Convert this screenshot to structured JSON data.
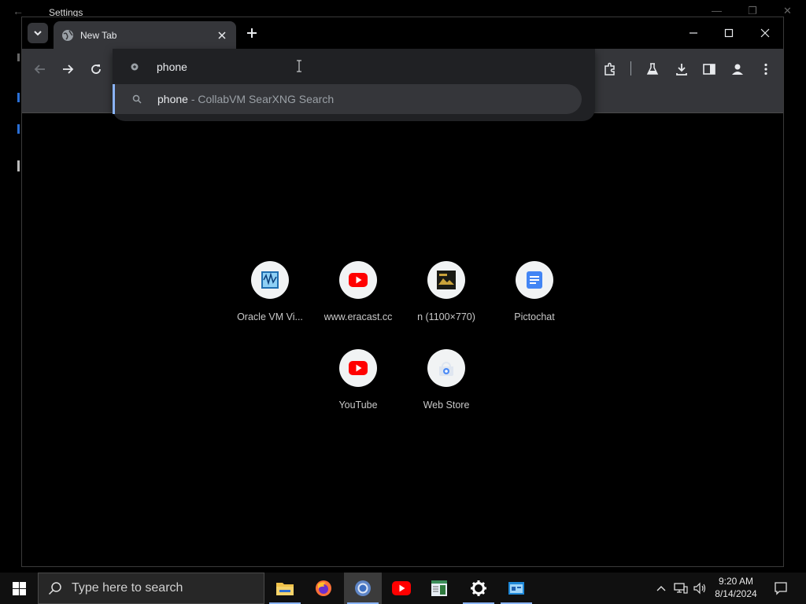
{
  "background_window": {
    "title": "Settings"
  },
  "browser": {
    "tab": {
      "label": "New Tab"
    },
    "omnibox": {
      "input_value": "phone",
      "suggestion_term": "phone",
      "suggestion_separator": " - ",
      "suggestion_engine": "CollabVM SearXNG Search"
    },
    "shortcuts": [
      {
        "label": "Oracle VM Vi...",
        "icon": "oracle-vm-icon"
      },
      {
        "label": "www.eracast.cc",
        "icon": "youtube-icon"
      },
      {
        "label": "n (1100×770)",
        "icon": "image-icon"
      },
      {
        "label": "Pictochat",
        "icon": "document-icon"
      },
      {
        "label": "YouTube",
        "icon": "youtube-icon"
      },
      {
        "label": "Web Store",
        "icon": "web-store-icon"
      }
    ],
    "colors": {
      "toolbar": "#35363a",
      "omnibox": "#202124",
      "accent": "#8ab4f8"
    }
  },
  "taskbar": {
    "search_placeholder": "Type here to search",
    "apps": [
      "file-explorer-icon",
      "firefox-icon",
      "chrome-icon",
      "youtube-icon",
      "notepad-icon",
      "settings-icon",
      "control-panel-icon"
    ],
    "clock_time": "9:20 AM",
    "clock_date": "8/14/2024"
  }
}
